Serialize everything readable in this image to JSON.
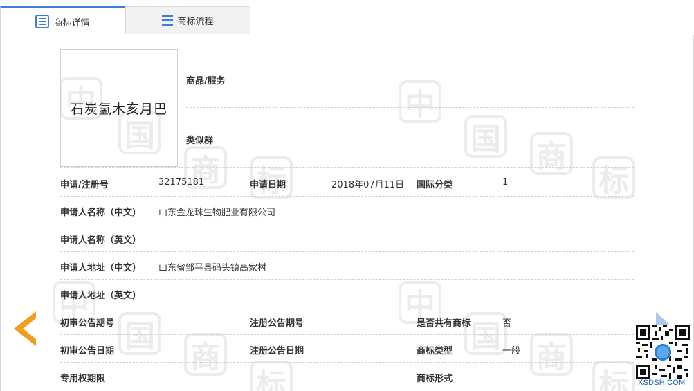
{
  "tabs": [
    {
      "label": "商标详情",
      "icon": "list-doc-icon",
      "active": true
    },
    {
      "label": "商标流程",
      "icon": "list-icon",
      "active": false
    }
  ],
  "logo": {
    "text": "石炭氢木亥月巴"
  },
  "goods": {
    "label": "商品/服务",
    "value": ""
  },
  "similar_group": {
    "label": "类似群",
    "value": ""
  },
  "fields": {
    "reg_no_label": "申请/注册号",
    "reg_no": "32175181",
    "apply_date_label": "申请日期",
    "apply_date": "2018年07月11日",
    "intl_class_label": "国际分类",
    "intl_class": "1",
    "applicant_cn_label": "申请人名称（中文）",
    "applicant_cn": "山东金龙珠生物肥业有限公司",
    "applicant_en_label": "申请人名称（英文）",
    "applicant_en": "",
    "address_cn_label": "申请人地址（中文）",
    "address_cn": "山东省邹平县码头镇高家村",
    "address_en_label": "申请人地址（英文）",
    "address_en": "",
    "prelim_no_label": "初审公告期号",
    "prelim_no": "",
    "reg_pub_no_label": "注册公告期号",
    "reg_pub_no": "",
    "shared_label": "是否共有商标",
    "shared": "否",
    "prelim_date_label": "初审公告日期",
    "prelim_date": "",
    "reg_pub_date_label": "注册公告日期",
    "reg_pub_date": "",
    "type_label": "商标类型",
    "type": "一般",
    "exclusive_label": "专用权期限",
    "exclusive": "",
    "form_label": "商标形式",
    "form": ""
  },
  "qr": {
    "caption": "XSDSH.COM"
  },
  "colors": {
    "accent": "#3b7fd6",
    "arrow": "#f39c1f",
    "watermark": "#ececec"
  }
}
